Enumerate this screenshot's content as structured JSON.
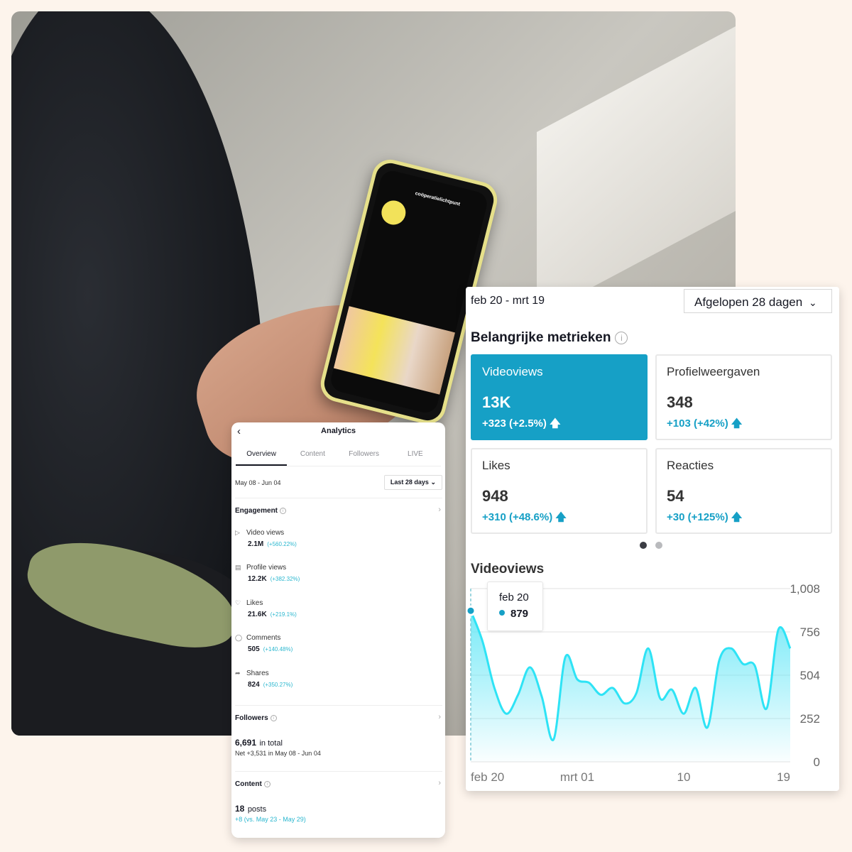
{
  "colors": {
    "accent": "#16a0c6",
    "line": "#2ee3f5",
    "positive": "#2bb7cf",
    "background": "#fdf4ec"
  },
  "phone": {
    "profile_name": "coöperatielichtpunt"
  },
  "analytics": {
    "title": "Analytics",
    "tabs": [
      {
        "label": "Overview",
        "active": true
      },
      {
        "label": "Content"
      },
      {
        "label": "Followers"
      },
      {
        "label": "LIVE"
      }
    ],
    "date_range": "May 08 - Jun 04",
    "range_select": "Last 28 days",
    "engagement": {
      "title": "Engagement",
      "metrics": [
        {
          "icon": "play-icon",
          "label": "Video views",
          "value": "2.1M",
          "change": "(+560.22%)"
        },
        {
          "icon": "profile-icon",
          "label": "Profile views",
          "value": "12.2K",
          "change": "(+382.32%)"
        },
        {
          "icon": "heart-icon",
          "label": "Likes",
          "value": "21.6K",
          "change": "(+219.1%)"
        },
        {
          "icon": "comment-icon",
          "label": "Comments",
          "value": "505",
          "change": "(+140.48%)"
        },
        {
          "icon": "share-icon",
          "label": "Shares",
          "value": "824",
          "change": "(+350.27%)"
        }
      ]
    },
    "followers": {
      "title": "Followers",
      "total": "6,691",
      "total_suffix": "in total",
      "net": "Net +3,531 in May 08 - Jun 04"
    },
    "content": {
      "title": "Content",
      "posts": "18",
      "posts_suffix": "posts",
      "change": "+8 (vs. May 23 - May 29)"
    }
  },
  "dashboard": {
    "date_range": "feb 20 - mrt 19",
    "range_select": "Afgelopen 28 dagen",
    "title": "Belangrijke metrieken",
    "metrics": [
      {
        "label": "Videoviews",
        "value": "13K",
        "change": "+323 (+2.5%)",
        "active": true
      },
      {
        "label": "Profielweergaven",
        "value": "348",
        "change": "+103 (+42%)"
      },
      {
        "label": "Likes",
        "value": "948",
        "change": "+310 (+48.6%)"
      },
      {
        "label": "Reacties",
        "value": "54",
        "change": "+30 (+125%)"
      }
    ],
    "pager": {
      "pages": 2,
      "current": 1
    },
    "tooltip": {
      "date": "feb 20",
      "value": "879"
    }
  },
  "chart_data": {
    "type": "area",
    "title": "Videoviews",
    "x": [
      "feb 20",
      "feb 21",
      "feb 22",
      "feb 23",
      "feb 24",
      "feb 25",
      "feb 26",
      "feb 27",
      "feb 28",
      "mrt 01",
      "mrt 02",
      "mrt 03",
      "mrt 04",
      "mrt 05",
      "mrt 06",
      "mrt 07",
      "mrt 08",
      "mrt 09",
      "mrt 10",
      "mrt 11",
      "mrt 12",
      "mrt 13",
      "mrt 14",
      "mrt 15",
      "mrt 16",
      "mrt 17",
      "mrt 18",
      "mrt 19"
    ],
    "values": [
      879,
      700,
      430,
      280,
      390,
      550,
      380,
      130,
      610,
      480,
      460,
      390,
      430,
      340,
      400,
      660,
      370,
      420,
      280,
      430,
      200,
      590,
      660,
      570,
      560,
      310,
      770,
      660
    ],
    "xticks": [
      "feb 20",
      "mrt 01",
      "10",
      "19"
    ],
    "xtick_index": [
      0,
      9,
      18,
      27
    ],
    "yticks": [
      "0",
      "252",
      "504",
      "756",
      "1,008"
    ],
    "ylim": [
      0,
      1008
    ],
    "grid": true,
    "legend": "none"
  }
}
